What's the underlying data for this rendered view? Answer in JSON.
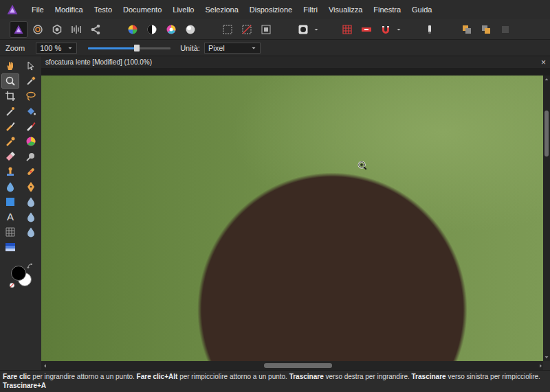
{
  "menu": [
    "File",
    "Modifica",
    "Testo",
    "Documento",
    "Livello",
    "Seleziona",
    "Disposizione",
    "Filtri",
    "Visualizza",
    "Finestra",
    "Guida"
  ],
  "toolbar": {
    "personas": [
      {
        "selected": true
      },
      {
        "selected": false
      },
      {
        "selected": false
      },
      {
        "selected": false
      },
      {
        "selected": false
      }
    ]
  },
  "context_bar": {
    "zoom_label": "Zoom",
    "zoom_value": "100 %",
    "zoom_level": 0.59,
    "units_label": "Unità:",
    "units_value": "Pixel"
  },
  "tools": [
    {
      "selected": false
    },
    {
      "selected": false
    },
    {
      "selected": true
    },
    {
      "selected": false
    },
    {
      "selected": false
    },
    {
      "selected": false
    },
    {
      "selected": false
    },
    {
      "selected": false
    },
    {
      "selected": false
    },
    {
      "selected": false
    },
    {
      "selected": false
    },
    {
      "selected": false
    },
    {
      "selected": false
    },
    {
      "selected": false
    },
    {
      "selected": false
    },
    {
      "selected": false
    },
    {
      "selected": false
    },
    {
      "selected": false
    },
    {
      "selected": false
    },
    {
      "selected": false
    },
    {
      "selected": false,
      "glyph": "A"
    },
    {
      "selected": false
    },
    {
      "selected": false
    },
    {
      "selected": false
    },
    {
      "selected": false
    }
  ],
  "colors": {
    "primary": "#000000",
    "secondary": "#ffffff"
  },
  "document": {
    "title": "sfocatura lente [Modified] (100.0%)",
    "close": "×"
  },
  "scrollbars": {
    "horizontal": {
      "start": 0.44,
      "size": 0.14
    },
    "vertical": {
      "start": 0.1,
      "size": 0.17
    }
  },
  "status_bar": [
    {
      "text": "Fare clic",
      "bold": true
    },
    {
      "text": " per ingrandire attorno a un punto. ",
      "bold": false
    },
    {
      "text": "Fare clic+Alt",
      "bold": true
    },
    {
      "text": " per rimpicciolire attorno a un punto. ",
      "bold": false
    },
    {
      "text": "Trascinare",
      "bold": true
    },
    {
      "text": " verso destra per ingrandire. ",
      "bold": false
    },
    {
      "text": "Trascinare",
      "bold": true
    },
    {
      "text": " verso sinistra per rimpicciolire. ",
      "bold": false
    },
    {
      "text": "Trascinare+A",
      "bold": true
    }
  ]
}
